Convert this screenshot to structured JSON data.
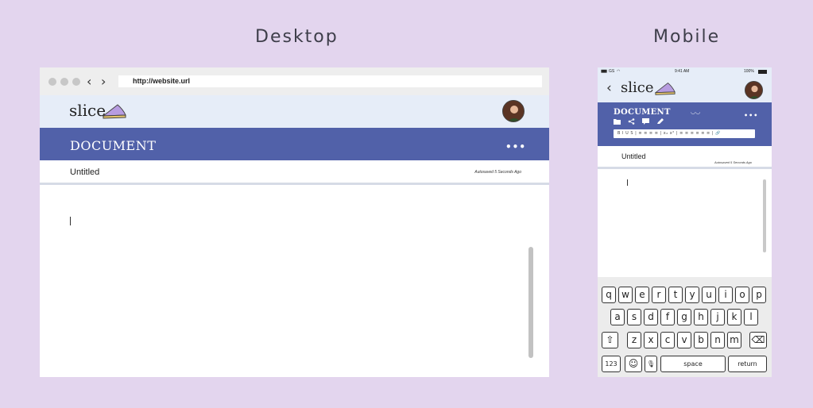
{
  "labels": {
    "desktop": "Desktop",
    "mobile": "Mobile"
  },
  "desktop": {
    "url": "http://website.url",
    "logo": "slice",
    "document_header": "DOCUMENT",
    "filename": "Untitled",
    "autosave": "Autosaved 5 Seconds Ago",
    "menu": "•••"
  },
  "mobile": {
    "status": {
      "carrier": "GS",
      "time": "9:41 AM",
      "battery": "100%"
    },
    "back": "‹",
    "logo": "slice",
    "document_header": "DOCUMENT",
    "toolbar_text": "B  I  U  S  |  ≡  ≡  ≡  ≡  |  x₂  x²  |  ≡  ≡  ≡  ≡  ≡  ≡  |  🔗",
    "filename": "Untitled",
    "autosave": "Autosaved 5 Seconds Ago",
    "menu": "•••",
    "keyboard": {
      "row1": [
        "q",
        "w",
        "e",
        "r",
        "t",
        "y",
        "u",
        "i",
        "o",
        "p"
      ],
      "row2": [
        "a",
        "s",
        "d",
        "f",
        "g",
        "h",
        "j",
        "k",
        "l"
      ],
      "row3": [
        "z",
        "x",
        "c",
        "v",
        "b",
        "n",
        "m"
      ],
      "numbers": "123",
      "space": "space",
      "return": "return"
    }
  },
  "colors": {
    "background": "#e3d5ee",
    "band": "#5161a9",
    "header": "#e6edf8",
    "pie": "#b79ce0"
  }
}
